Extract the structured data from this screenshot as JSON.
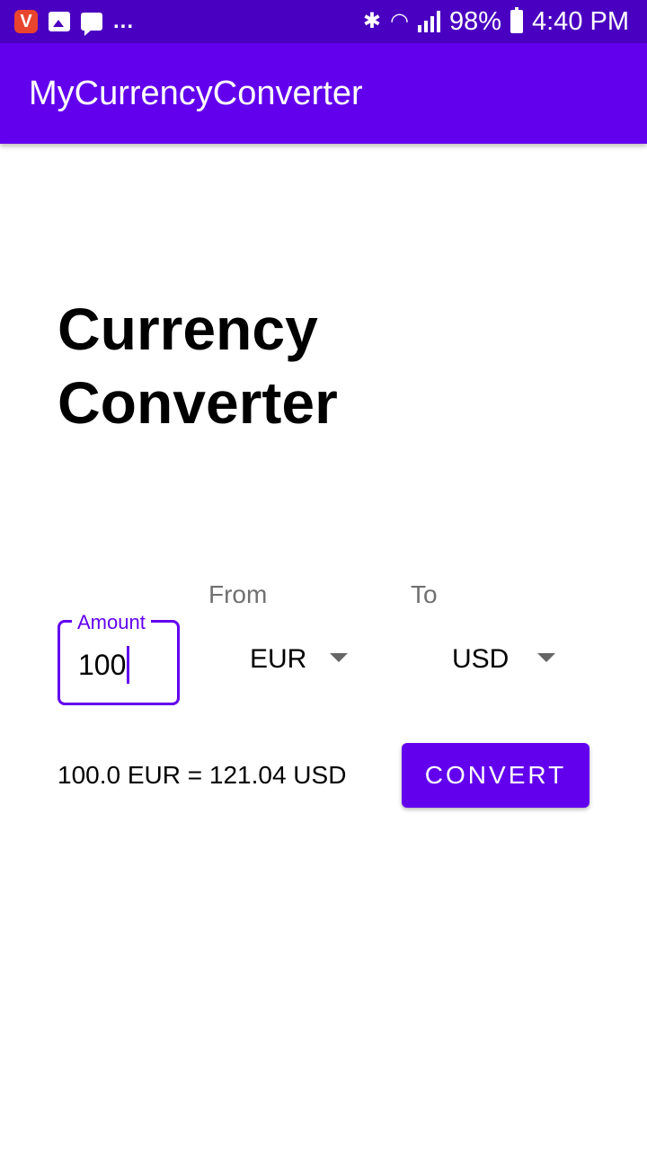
{
  "status_bar": {
    "notification_icons": [
      "vivaldi-app-icon",
      "image-icon",
      "message-icon"
    ],
    "more_indicator": "...",
    "battery_percent": "98%",
    "time": "4:40 PM"
  },
  "app_bar": {
    "title": "MyCurrencyConverter"
  },
  "main": {
    "heading_line1": "Currency",
    "heading_line2": "Converter",
    "from_label": "From",
    "to_label": "To",
    "amount": {
      "label": "Amount",
      "value": "100"
    },
    "from_currency": "EUR",
    "to_currency": "USD",
    "result_text": "100.0 EUR = 121.04 USD",
    "convert_button_label": "CONVERT"
  },
  "colors": {
    "primary": "#6200ee",
    "status_bar": "#4a00c0"
  }
}
